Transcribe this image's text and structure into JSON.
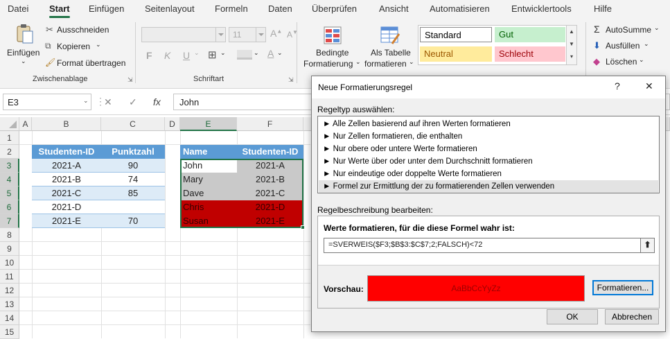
{
  "tabs": [
    "Datei",
    "Start",
    "Einfügen",
    "Seitenlayout",
    "Formeln",
    "Daten",
    "Überprüfen",
    "Ansicht",
    "Automatisieren",
    "Entwicklertools",
    "Hilfe"
  ],
  "ribbon": {
    "paste_label": "Einfügen",
    "cut_label": "Ausschneiden",
    "copy_label": "Kopieren",
    "format_painter_label": "Format übertragen",
    "clipboard_group": "Zwischenablage",
    "font_size": "11",
    "bold": "F",
    "italic": "K",
    "underline": "U",
    "font_group": "Schriftart",
    "cond_format_line1": "Bedingte",
    "cond_format_line2": "Formatierung",
    "as_table_line1": "Als Tabelle",
    "as_table_line2": "formatieren",
    "styles": {
      "standard": "Standard",
      "good": "Gut",
      "neutral": "Neutral",
      "bad": "Schlecht"
    },
    "autosum_label": "AutoSumme",
    "fill_label": "Ausfüllen",
    "clear_label": "Löschen"
  },
  "formula_bar": {
    "name_box": "E3",
    "cancel": "✕",
    "confirm": "✓",
    "fx": "fx",
    "value": "John"
  },
  "grid": {
    "columns": [
      "A",
      "B",
      "C",
      "D",
      "E",
      "F"
    ],
    "rows": [
      "1",
      "2",
      "3",
      "4",
      "5",
      "6",
      "7",
      "8",
      "9",
      "10",
      "11",
      "12",
      "13",
      "14",
      "15"
    ],
    "table1": {
      "headers": [
        "Studenten-ID",
        "Punktzahl"
      ],
      "rows": [
        [
          "2021-A",
          "90"
        ],
        [
          "2021-B",
          "74"
        ],
        [
          "2021-C",
          "85"
        ],
        [
          "2021-D",
          ""
        ],
        [
          "2021-E",
          "70"
        ]
      ]
    },
    "table2": {
      "headers": [
        "Name",
        "Studenten-ID"
      ],
      "rows": [
        [
          "John",
          "2021-A"
        ],
        [
          "Mary",
          "2021-B"
        ],
        [
          "Dave",
          "2021-C"
        ],
        [
          "Chris",
          "2021-D"
        ],
        [
          "Susan",
          "2021-E"
        ]
      ]
    }
  },
  "dialog": {
    "title": "Neue Formatierungsregel",
    "help": "?",
    "close": "✕",
    "ruletype_label": "Regeltyp auswählen:",
    "ruletypes": [
      "Alle Zellen basierend auf ihren Werten formatieren",
      "Nur Zellen formatieren, die enthalten",
      "Nur obere oder untere Werte formatieren",
      "Nur Werte über oder unter dem Durchschnitt formatieren",
      "Nur eindeutige oder doppelte Werte formatieren",
      "Formel zur Ermittlung der zu formatierenden Zellen verwenden"
    ],
    "ruletype_bullet": "►",
    "desc_label": "Regelbeschreibung bearbeiten:",
    "formula_label": "Werte formatieren, für die diese Formel wahr ist:",
    "formula": "=SVERWEIS($F3;$B$3:$C$7;2;FALSCH)<72",
    "collapse_icon": "⬆",
    "preview_label": "Vorschau:",
    "preview_text": "AaBbCcYyZz",
    "format_button": "Formatieren...",
    "ok_button": "OK",
    "cancel_button": "Abbrechen"
  },
  "colors": {
    "accent": "#217346",
    "table_header": "#5b9bd5",
    "band": "#ddebf7",
    "highlight_gray": "#c9c9c9",
    "highlight_red": "#c00000",
    "preview_red": "#ff0000"
  }
}
